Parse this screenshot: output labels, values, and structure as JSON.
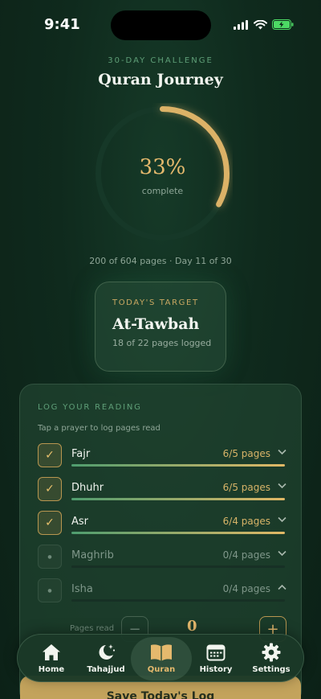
{
  "status": {
    "time": "9:41"
  },
  "challenge": {
    "label": "30-DAY CHALLENGE",
    "title": "Quran Journey",
    "percent": "33%",
    "percent_value": 0.33,
    "complete_label": "complete",
    "progress_text": "200 of 604 pages · Day 11 of 30"
  },
  "target": {
    "label": "TODAY'S TARGET",
    "surah": "At-Tawbah",
    "pages": "18 of 22 pages logged"
  },
  "log": {
    "title": "LOG YOUR READING",
    "hint": "Tap a prayer to log pages read",
    "prayers": [
      {
        "name": "Fajr",
        "value": "6/5 pages",
        "checked": true,
        "fill": 1.0,
        "expanded": false
      },
      {
        "name": "Dhuhr",
        "value": "6/5 pages",
        "checked": true,
        "fill": 1.0,
        "expanded": false
      },
      {
        "name": "Asr",
        "value": "6/4 pages",
        "checked": true,
        "fill": 1.0,
        "expanded": false
      },
      {
        "name": "Maghrib",
        "value": "0/4 pages",
        "checked": false,
        "fill": 0,
        "expanded": false
      },
      {
        "name": "Isha",
        "value": "0/4 pages",
        "checked": false,
        "fill": 0,
        "expanded": true
      }
    ],
    "stepper": {
      "label": "Pages read",
      "value": "0",
      "minus": "−",
      "plus": "+"
    },
    "save_label": "Save Today's Log"
  },
  "tabs": [
    {
      "label": "Home",
      "icon": "home-icon"
    },
    {
      "label": "Tahajjud",
      "icon": "moon-stars-icon"
    },
    {
      "label": "Quran",
      "icon": "book-icon",
      "active": true
    },
    {
      "label": "History",
      "icon": "calendar-icon"
    },
    {
      "label": "Settings",
      "icon": "gear-icon"
    }
  ],
  "colors": {
    "accent": "#e5b96d",
    "green": "#5f9f78",
    "background": "#0f2a1d"
  }
}
